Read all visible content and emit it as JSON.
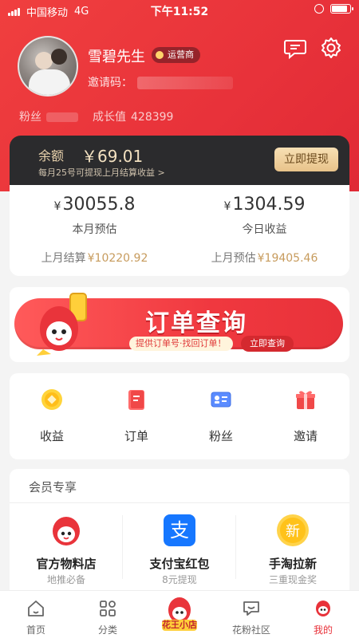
{
  "status_bar": {
    "carrier": "中国移动",
    "network": "4G",
    "time": "下午11:52"
  },
  "profile": {
    "name": "雪碧先生",
    "level": "运营商",
    "invite_label": "邀请码：",
    "fans_label": "粉丝",
    "growth_label": "成长值",
    "growth_value": "428399"
  },
  "balance": {
    "label": "余额",
    "amount": "￥69.01",
    "note": "每月25号可提现上月结算收益 >",
    "withdraw": "立即提现"
  },
  "earnings": {
    "month_value": "30055.8",
    "month_label": "本月预估",
    "today_value": "1304.59",
    "today_label": "今日收益",
    "last_settle_label": "上月结算",
    "last_settle_value": "¥10220.92",
    "last_estimate_label": "上月预估",
    "last_estimate_value": "¥19405.46",
    "currency": "¥"
  },
  "banner": {
    "title": "订单查询",
    "tagline": "提供订单号·找回订单！",
    "button": "立即查询"
  },
  "shortcuts": [
    {
      "label": "收益",
      "icon": "coin-icon"
    },
    {
      "label": "订单",
      "icon": "order-icon"
    },
    {
      "label": "粉丝",
      "icon": "fans-card-icon"
    },
    {
      "label": "邀请",
      "icon": "gift-icon"
    }
  ],
  "member": {
    "title": "会员专享",
    "items": [
      {
        "title": "官方物料店",
        "sub": "地推必备",
        "icon": "mascot-icon"
      },
      {
        "title": "支付宝红包",
        "sub": "8元提现",
        "icon": "alipay-icon"
      },
      {
        "title": "手淘拉新",
        "sub": "三重现金奖",
        "icon": "new-badge-icon"
      }
    ],
    "new_badge_text": "新",
    "alipay_glyph": "支"
  },
  "tabbar": {
    "items": [
      {
        "label": "首页"
      },
      {
        "label": "分类"
      },
      {
        "label": "花王小店"
      },
      {
        "label": "花粉社区"
      },
      {
        "label": "我的"
      }
    ]
  },
  "colors": {
    "brand_red": "#e8323a",
    "gold": "#c79b5d",
    "dark_card": "#2b2b2d"
  }
}
